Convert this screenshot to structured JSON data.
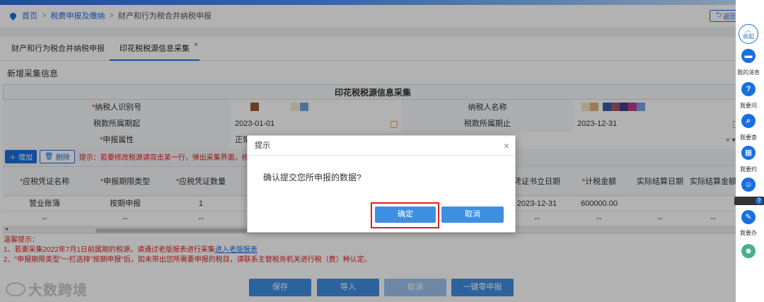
{
  "breadcrumb": {
    "home": "首页",
    "level1": "税费申报及缴纳",
    "current": "财产和行为税合并纳税申报",
    "separator": ">"
  },
  "back_button": "返回",
  "tabs": [
    {
      "label": "财产和行为税合并纳税申报"
    },
    {
      "label": "印花税税源信息采集",
      "close": "×"
    }
  ],
  "section_title": "新增采集信息",
  "form": {
    "title": "印花税税源信息采集",
    "taxpayer_id_label": "纳税人识别号",
    "taxpayer_name_label": "纳税人名称",
    "period_start_label": "税款所属期起",
    "period_start_value": "2023-01-01",
    "period_end_label": "税款所属期止",
    "period_end_value": "2023-12-31",
    "declare_attr_label": "申报属性",
    "declare_attr_value": "正常",
    "required_mark": "*"
  },
  "toolbar": {
    "add_label": "增加",
    "delete_label": "删除",
    "tip": "提示：若要修改税源请双击某一行，弹出采集界面，修改后请"
  },
  "grid": {
    "headers": [
      "应税凭证名称",
      "申报期限类型",
      "应税凭证数量",
      "凭证书立日期",
      "计税金额",
      "实际结算日期",
      "实际结算金额"
    ],
    "rows": [
      [
        "营业账簿",
        "按期申报",
        "1",
        "2023-12-31",
        "600000.00",
        "",
        ""
      ],
      [
        "--",
        "--",
        "--",
        "--",
        "--",
        "--",
        "--"
      ]
    ]
  },
  "notes": {
    "title": "温馨提示：",
    "line1": "1、若要采集2022年7月1日前属期的税源，请通过老版报表进行采集",
    "line1_link": "进入老版报表",
    "line2": "2、\"申报期限类型\"一栏选择\"按期申报\"后，如未带出您所需要申报的税目，请联系主管税务机关进行税（费）种认定。"
  },
  "bottom_buttons": {
    "save": "保存",
    "import": "导入",
    "cancel": "取消",
    "zero_declare": "一键零申报"
  },
  "watermark": "大数跨境",
  "dialog": {
    "title": "提示",
    "close": "×",
    "message": "确认提交您所申报的数据?",
    "ok": "确定",
    "cancel": "取消"
  },
  "sidebar": {
    "fold": "收起",
    "items": [
      {
        "label": "我的消息",
        "icon": "message-icon"
      },
      {
        "label": "我要问",
        "icon": "question-icon"
      },
      {
        "label": "我要查",
        "icon": "search-icon"
      },
      {
        "label": "我要约",
        "icon": "calendar-icon"
      },
      {
        "label": "我要办",
        "icon": "edit-icon"
      }
    ]
  },
  "colors": {
    "primary": "#1a6fe0",
    "button": "#3f8fe0",
    "warning_text": "#e02020",
    "highlight_outline": "#e02020"
  }
}
